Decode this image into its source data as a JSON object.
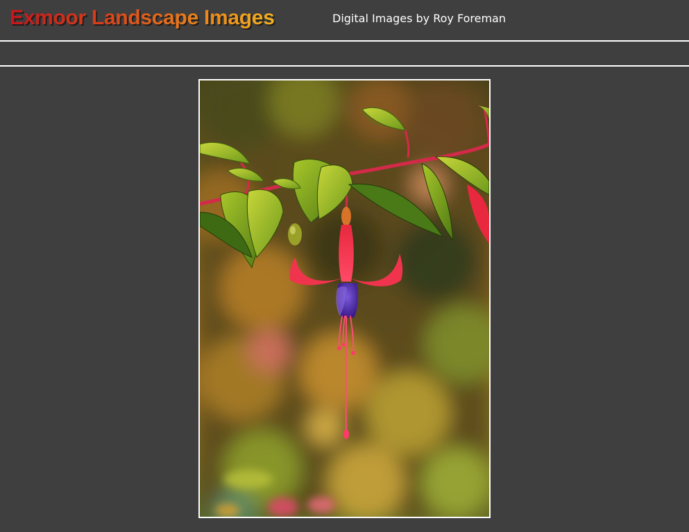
{
  "header": {
    "site_title": "Exmoor Landscape Images",
    "tagline": "Digital Images by Roy Foreman"
  },
  "colors": {
    "background": "#3f3f3f",
    "rule": "#ffffff",
    "title_gradient_start": "#c4161c",
    "title_gradient_end": "#f2b21f",
    "tagline": "#ffffff"
  },
  "photo": {
    "subject": "fuchsia-flower-photo"
  }
}
